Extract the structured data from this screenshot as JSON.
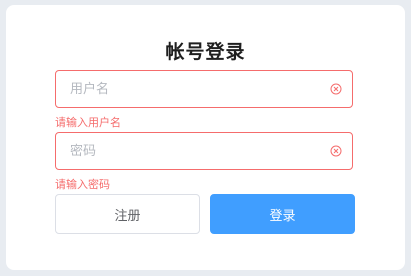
{
  "form": {
    "title": "帐号登录",
    "username": {
      "placeholder": "用户名",
      "value": "",
      "error": "请输入用户名"
    },
    "password": {
      "placeholder": "密码",
      "value": "",
      "error": "请输入密码"
    },
    "register_label": "注册",
    "login_label": "登录"
  },
  "colors": {
    "error": "#f56c6c",
    "primary": "#409eff",
    "background": "#e8ecf1"
  },
  "icons": {
    "clear": "circle-close-icon"
  }
}
